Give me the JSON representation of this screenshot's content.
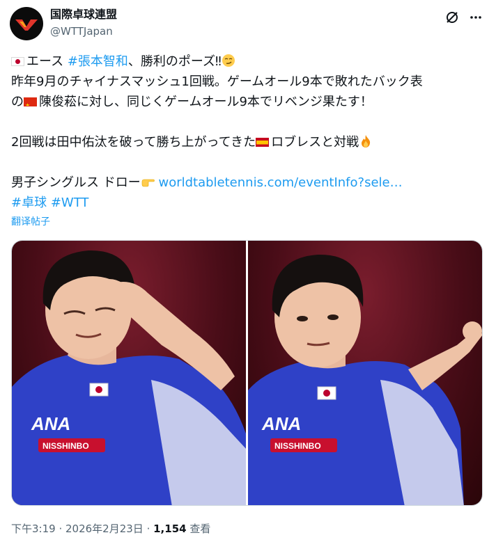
{
  "header": {
    "display_name": "国際卓球連盟",
    "handle": "@WTTJapan",
    "avatar_icon": "wtt-logo",
    "grok_icon": "grok-icon",
    "more_icon": "more-icon"
  },
  "tweet": {
    "line1": {
      "flag": "jp",
      "text_a": "エース ",
      "hashtag": "#張本智和",
      "text_b": "、勝利のポーズ‼",
      "emoji": "smirk-emoji"
    },
    "line2": "昨年9月のチャイナスマッシュ1回戦。ゲームオール9本で敗れたバック表",
    "line3": {
      "text_a": "の",
      "flag": "cn",
      "text_b": "陳俊菘に対し、同じくゲームオール9本でリベンジ果たす！"
    },
    "line4": {
      "text_a": "2回戦は田中佑汰を破って勝ち上がってきた",
      "flag": "es",
      "text_b": "ロブレスと対戦",
      "emoji": "fire-emoji"
    },
    "line5": {
      "text_a": "男子シングルス ドロー",
      "emoji": "pointing-hand-emoji",
      "link": "worldtabletennis.com/eventInfo?sele…"
    },
    "line6": {
      "hashtag1": "#卓球",
      "hashtag2": "#WTT"
    },
    "translate_label": "翻译帖子"
  },
  "media": {
    "photos": [
      {
        "description_icon": "photo-player-salute"
      },
      {
        "description_icon": "photo-player-pointing"
      }
    ],
    "jersey_text": "ANA",
    "sponsor_text": "NISSHINBO"
  },
  "footer": {
    "time": "下午3:19",
    "sep1": " · ",
    "date": "2026年2月23日",
    "sep2": " · ",
    "views_count": "1,154",
    "views_label": " 查看"
  },
  "colors": {
    "link": "#1d9bf0",
    "secondary": "#536471",
    "primary": "#0f1419"
  }
}
